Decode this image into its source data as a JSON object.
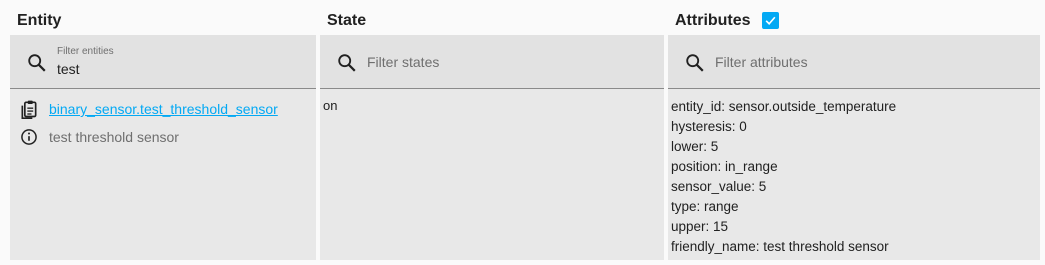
{
  "headers": {
    "entity": "Entity",
    "state": "State",
    "attributes": "Attributes",
    "attributes_checked": true
  },
  "filters": {
    "entity": {
      "label": "Filter entities",
      "value": "test"
    },
    "state": {
      "placeholder": "Filter states"
    },
    "attributes": {
      "placeholder": "Filter attributes"
    }
  },
  "row": {
    "entity_id": "binary_sensor.test_threshold_sensor",
    "friendly_name": "test threshold sensor",
    "state": "on",
    "attributes": [
      "entity_id: sensor.outside_temperature",
      "hysteresis: 0",
      "lower: 5",
      "position: in_range",
      "sensor_value: 5",
      "type: range",
      "upper: 15",
      "friendly_name: test threshold sensor"
    ]
  },
  "icons": {
    "search": "search-icon",
    "copy": "clipboard-icon",
    "info": "info-icon",
    "check": "check-icon"
  },
  "colors": {
    "accent": "#03a9f4",
    "panel": "#e8e8e8",
    "text": "#212121",
    "muted": "#6f6f6f"
  }
}
